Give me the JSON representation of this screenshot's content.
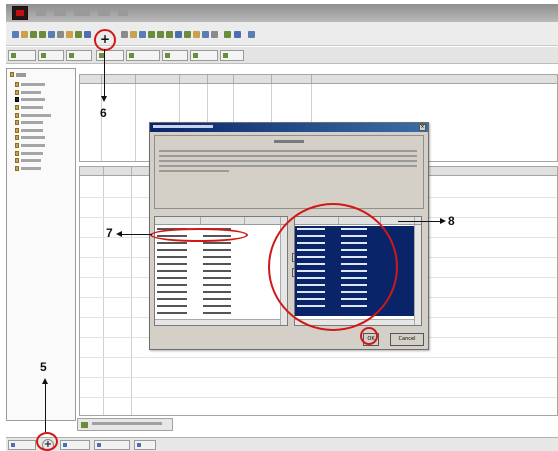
{
  "theme": {
    "accent": "#d01818",
    "title_bar": "#0a246a",
    "selection": "#0a246a",
    "dialog_face": "#d4d0c8"
  },
  "icons": {
    "toolbar_add": "plus-icon",
    "status_add": "plus-icon",
    "dialog_close": "close-icon",
    "move_right": "arrow-right-icon",
    "move_left": "arrow-left-icon"
  },
  "annotations": {
    "step5": "5",
    "step6": "6",
    "step7": "7",
    "step8": "8"
  },
  "dialog": {
    "ok_label": "OK",
    "cancel_label": "Cancel",
    "close_glyph": "×",
    "move_right_glyph": "►",
    "move_left_glyph": "◄"
  },
  "toolbar": {
    "add_glyph": "+"
  },
  "statusbar": {
    "add_glyph": "+"
  }
}
